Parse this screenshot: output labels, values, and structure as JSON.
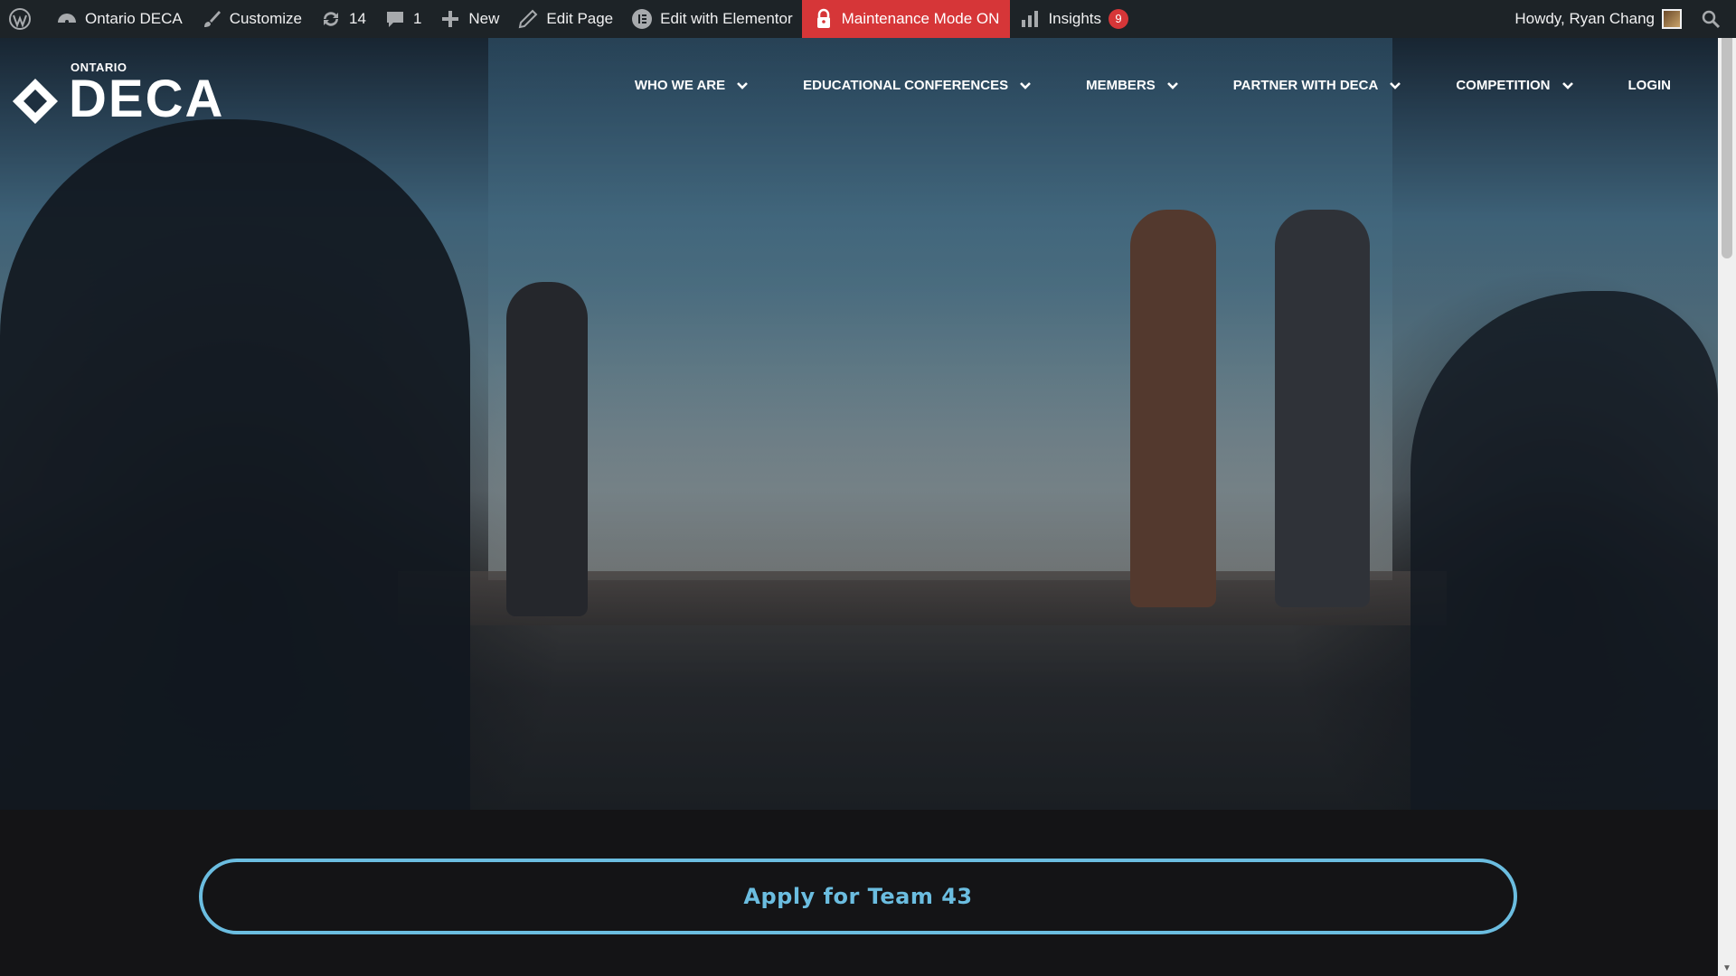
{
  "adminbar": {
    "site_name": "Ontario DECA",
    "customize": "Customize",
    "updates_count": "14",
    "comments_count": "1",
    "new_label": "New",
    "edit_page": "Edit Page",
    "edit_elementor": "Edit with Elementor",
    "maintenance": "Maintenance Mode ON",
    "insights": "Insights",
    "insights_badge": "9",
    "greeting": "Howdy, Ryan Chang"
  },
  "logo": {
    "small": "ONTARIO",
    "big": "DECA"
  },
  "nav": {
    "items": [
      {
        "label": "WHO WE ARE",
        "dropdown": true
      },
      {
        "label": "EDUCATIONAL CONFERENCES",
        "dropdown": true
      },
      {
        "label": "MEMBERS",
        "dropdown": true
      },
      {
        "label": "PARTNER WITH DECA",
        "dropdown": true
      },
      {
        "label": "COMPETITION",
        "dropdown": true
      },
      {
        "label": "LOGIN",
        "dropdown": false
      }
    ]
  },
  "cta": {
    "label": "Apply for Team 43"
  },
  "colors": {
    "adminbar_bg": "#1d2327",
    "maintenance_bg": "#d63638",
    "accent": "#6bbde0",
    "band_bg": "#141416"
  }
}
